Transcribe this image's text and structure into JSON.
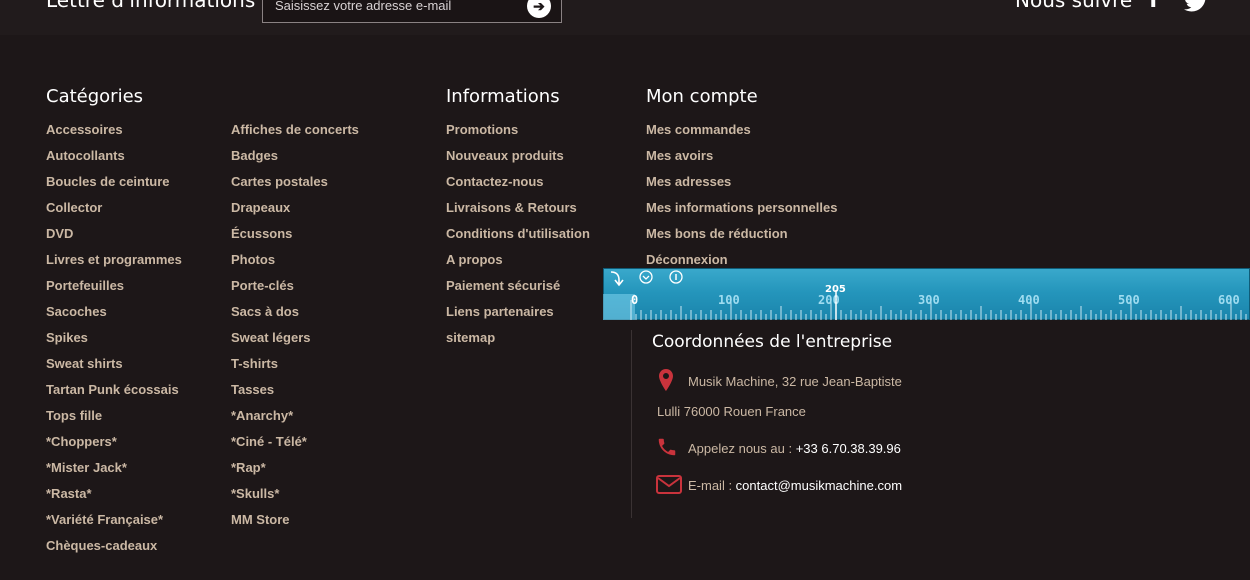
{
  "newsletter": {
    "title": "Lettre d'informations",
    "placeholder": "Saisissez votre adresse e-mail",
    "send_glyph": "➔"
  },
  "social": {
    "title": "Nous suivre",
    "facebook_glyph": "f",
    "icons": [
      "facebook-icon",
      "twitter-icon"
    ]
  },
  "categories": {
    "title": "Catégories",
    "col1": [
      "Accessoires",
      "Autocollants",
      "Boucles de ceinture",
      "Collector",
      "DVD",
      "Livres et programmes",
      "Portefeuilles",
      "Sacoches",
      "Spikes",
      "Sweat shirts",
      "Tartan Punk écossais",
      "Tops fille",
      "*Choppers*",
      "*Mister Jack*",
      "*Rasta*",
      "*Variété Française*",
      "Chèques-cadeaux"
    ],
    "col2": [
      "Affiches de concerts",
      "Badges",
      "Cartes postales",
      "Drapeaux",
      "Écussons",
      "Photos",
      "Porte-clés",
      "Sacs à dos",
      "Sweat légers",
      "T-shirts",
      "Tasses",
      "*Anarchy*",
      "*Ciné - Télé*",
      "*Rap*",
      "*Skulls*",
      "MM Store"
    ]
  },
  "informations": {
    "title": "Informations",
    "items": [
      "Promotions",
      "Nouveaux produits",
      "Contactez-nous",
      "Livraisons & Retours",
      "Conditions d'utilisation",
      "A propos",
      "Paiement sécurisé",
      "Liens partenaires",
      "sitemap"
    ]
  },
  "account": {
    "title": "Mon compte",
    "items": [
      "Mes commandes",
      "Mes avoirs",
      "Mes adresses",
      "Mes informations personnelles",
      "Mes bons de réduction",
      "Déconnexion"
    ]
  },
  "ruler": {
    "marker_value": "205",
    "labels": [
      "0",
      "100",
      "200",
      "300",
      "400",
      "500",
      "600"
    ],
    "icons": [
      "rotate-icon",
      "chevron-down-icon",
      "info-icon"
    ]
  },
  "company": {
    "title": "Coordonnées de l'entreprise",
    "address_line1": "Musik Machine, 32 rue Jean-Baptiste",
    "address_line2": "Lulli 76000 Rouen France",
    "phone_label": "Appelez nous au : ",
    "phone": "+33 6.70.38.39.96",
    "email_label": "E-mail : ",
    "email": "contact@musikmachine.com",
    "accent_color": "#c9333c"
  }
}
